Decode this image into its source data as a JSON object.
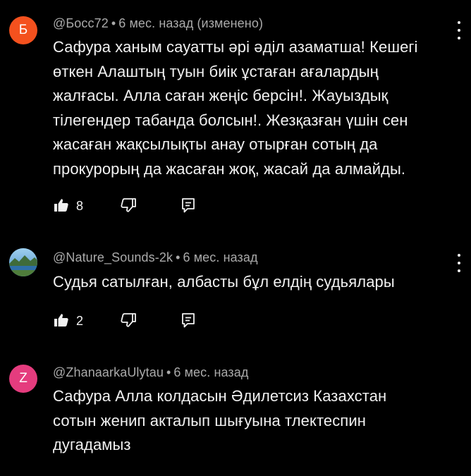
{
  "comments": [
    {
      "avatar_letter": "Б",
      "avatar_color": "#f4511e",
      "author": "@Босс72",
      "time": "6 мес. назад (изменено)",
      "lines": [
        "Сафура ханым сауатты әрі әділ азаматша! Кешегі",
        "өткен Алаштың туын биік ұстаған ағалардың",
        "жалғасы. Алла саған жеңіс берсін!. Жауыздық",
        "тілегендер табанда болсын!. Жезқазған үшін сен",
        "жасаған жақсылықты анау отырған сотың да",
        "прокурорың да жасаған жоқ, жасай да алмайды."
      ],
      "likes": "8"
    },
    {
      "avatar_letter": "",
      "avatar_color": "#3a7bbf",
      "author": "@Nature_Sounds-2k",
      "time": "6 мес. назад",
      "lines": [
        "Судья сатылған, албасты бұл елдің судьялары"
      ],
      "likes": "2"
    },
    {
      "avatar_letter": "Z",
      "avatar_color": "#e53c7e",
      "author": "@ZhanaarkaUlytau",
      "time": "6 мес. назад",
      "lines": [
        "Сафура Алла колдасын Әдилетсиз Казахстан",
        "сотын женип акталып шығуына  тлектеспин",
        "дугадамыз"
      ],
      "likes": ""
    }
  ],
  "icons": {
    "like": "thumb-up-icon",
    "dislike": "thumb-down-icon",
    "reply": "reply-icon",
    "more": "more-vert-icon"
  }
}
